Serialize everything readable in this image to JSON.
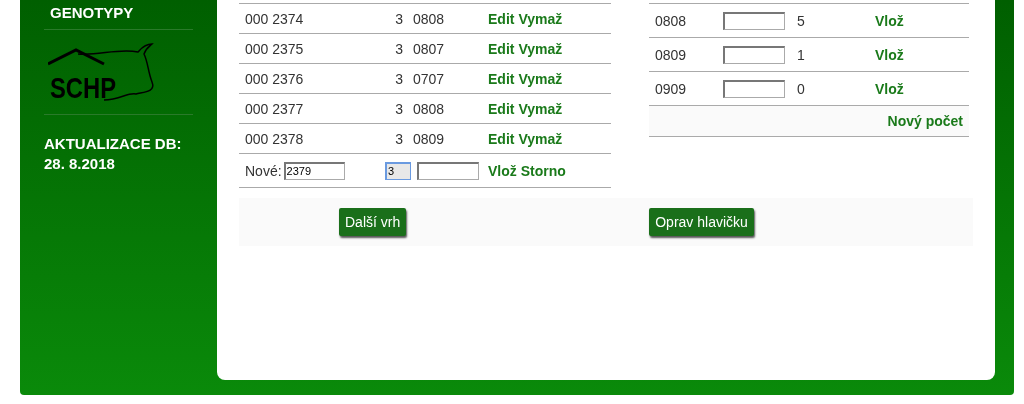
{
  "sidebar": {
    "title": "GENOTYPY",
    "logo_text": "SCHP",
    "update_label": "AKTUALIZACE DB:",
    "update_date": "28. 8.2018"
  },
  "left_table": {
    "rows": [
      {
        "number": "000 2374",
        "count": "3",
        "code": "0808",
        "actions": [
          "Edit",
          "Vymaž"
        ]
      },
      {
        "number": "000 2375",
        "count": "3",
        "code": "0807",
        "actions": [
          "Edit",
          "Vymaž"
        ]
      },
      {
        "number": "000 2376",
        "count": "3",
        "code": "0707",
        "actions": [
          "Edit",
          "Vymaž"
        ]
      },
      {
        "number": "000 2377",
        "count": "3",
        "code": "0808",
        "actions": [
          "Edit",
          "Vymaž"
        ]
      },
      {
        "number": "000 2378",
        "count": "3",
        "code": "0809",
        "actions": [
          "Edit",
          "Vymaž"
        ]
      }
    ],
    "new_row": {
      "label": "Nové:",
      "number_value": "2379",
      "count_value": "3",
      "count_focused": true,
      "actions": [
        "Vlož",
        "Storno"
      ]
    }
  },
  "right_table": {
    "rows": [
      {
        "code": "0808",
        "count": "5",
        "action": "Vlož"
      },
      {
        "code": "0809",
        "count": "1",
        "action": "Vlož"
      },
      {
        "code": "0909",
        "count": "0",
        "action": "Vlož"
      }
    ],
    "footer_link": "Nový počet"
  },
  "buttons": [
    "Další vrh",
    "Oprav hlavičku"
  ]
}
